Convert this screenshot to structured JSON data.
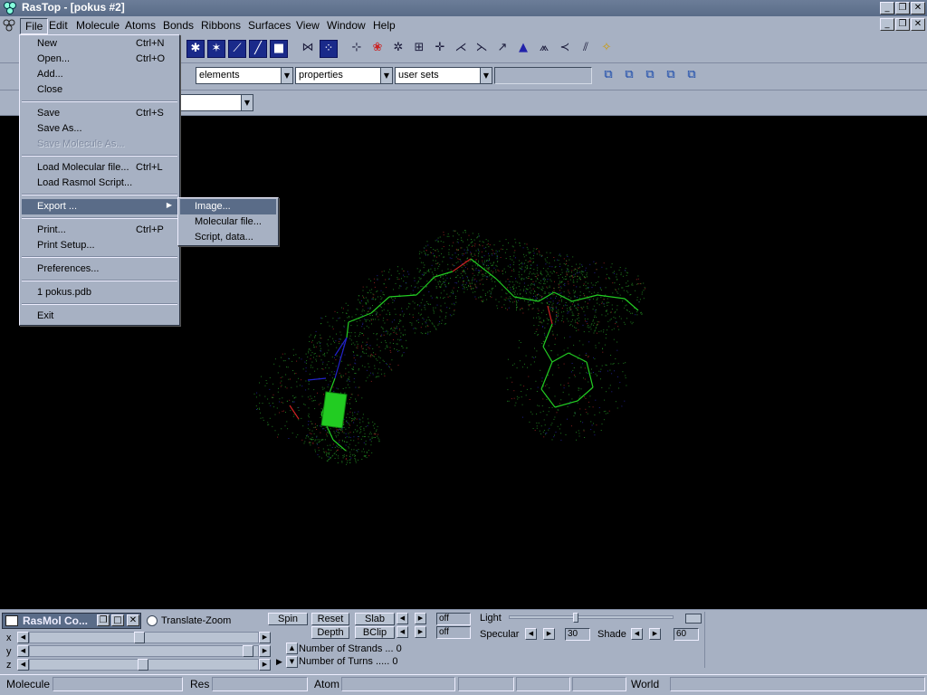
{
  "window": {
    "title": "RasTop - [pokus #2]"
  },
  "menubar": [
    "File",
    "Edit",
    "Molecule",
    "Atoms",
    "Bonds",
    "Ribbons",
    "Surfaces",
    "View",
    "Window",
    "Help"
  ],
  "file_menu": [
    {
      "label": "New",
      "shortcut": "Ctrl+N"
    },
    {
      "label": "Open...",
      "shortcut": "Ctrl+O"
    },
    {
      "label": "Add...",
      "shortcut": ""
    },
    {
      "label": "Close",
      "shortcut": ""
    },
    {
      "label": "Save",
      "shortcut": "Ctrl+S"
    },
    {
      "label": "Save As...",
      "shortcut": ""
    },
    {
      "label": "Save Molecule As...",
      "shortcut": "",
      "disabled": true
    },
    {
      "label": "Load Molecular file...",
      "shortcut": "Ctrl+L"
    },
    {
      "label": "Load Rasmol Script...",
      "shortcut": ""
    },
    {
      "label": "Export ...",
      "shortcut": "",
      "submenu": true
    },
    {
      "label": "Print...",
      "shortcut": "Ctrl+P"
    },
    {
      "label": "Print Setup...",
      "shortcut": ""
    },
    {
      "label": "Preferences...",
      "shortcut": ""
    },
    {
      "label": "1 pokus.pdb",
      "shortcut": ""
    },
    {
      "label": "Exit",
      "shortcut": ""
    }
  ],
  "export_submenu": [
    "Image...",
    "Molecular file...",
    "Script, data..."
  ],
  "toolbar": {
    "combo_elements": "elements",
    "combo_properties": "properties",
    "combo_user_sets": "user sets"
  },
  "bottom": {
    "command_window_title": "RasMol Co...",
    "translate_zoom": "Translate-Zoom",
    "axes": [
      "x",
      "y",
      "z"
    ],
    "spin": "Spin",
    "reset": "Reset",
    "slab": "Slab",
    "depth": "Depth",
    "bclip": "BClip",
    "slab_value": "off",
    "bclip_value": "off",
    "light": "Light",
    "specular": "Specular",
    "specular_value": "30",
    "shade": "Shade",
    "shade_value": "60",
    "strands_text": "Number of Strands ... 0",
    "turns_text": "Number of Turns ..... 0"
  },
  "status": {
    "molecule": "Molecule",
    "res": "Res",
    "atom": "Atom",
    "world": "World"
  },
  "colors": {
    "chrome": "#a7b1c3",
    "viewport": "#000000",
    "highlight": "#5a6c88",
    "bond_green": "#22cc22",
    "oxygen_red": "#cc2222",
    "nitrogen_blue": "#2222cc"
  }
}
